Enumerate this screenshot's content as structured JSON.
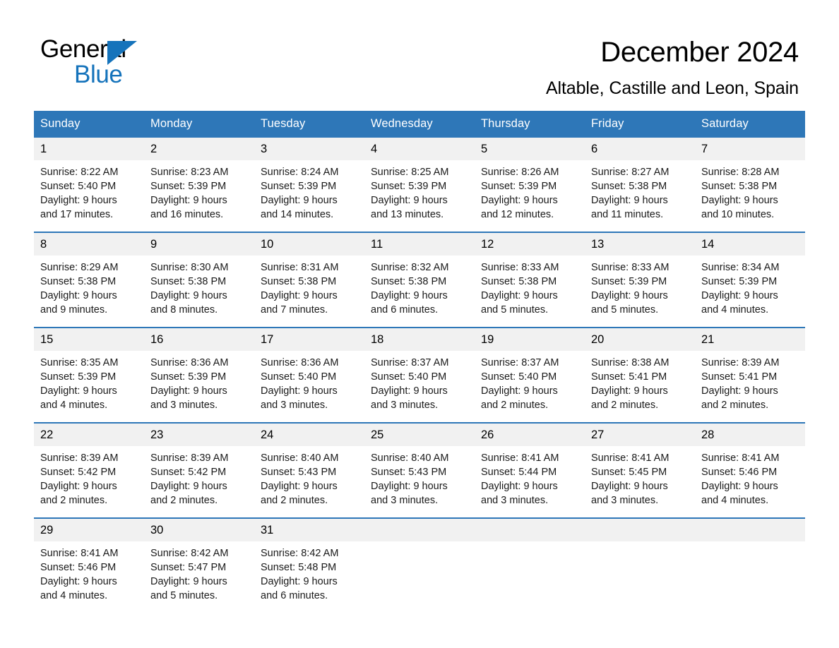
{
  "brand": {
    "word1": "General",
    "word2": "Blue",
    "triangle_color": "#1573bb"
  },
  "header": {
    "title": "December 2024",
    "subtitle": "Altable, Castille and Leon, Spain"
  },
  "theme": {
    "header_blue": "#2e77b8",
    "daynum_bg": "#f1f1f1",
    "page_bg": "#ffffff"
  },
  "weekday_headers": [
    "Sunday",
    "Monday",
    "Tuesday",
    "Wednesday",
    "Thursday",
    "Friday",
    "Saturday"
  ],
  "weeks": [
    [
      {
        "day": "1",
        "sunrise": "Sunrise: 8:22 AM",
        "sunset": "Sunset: 5:40 PM",
        "daylight1": "Daylight: 9 hours",
        "daylight2": "and 17 minutes."
      },
      {
        "day": "2",
        "sunrise": "Sunrise: 8:23 AM",
        "sunset": "Sunset: 5:39 PM",
        "daylight1": "Daylight: 9 hours",
        "daylight2": "and 16 minutes."
      },
      {
        "day": "3",
        "sunrise": "Sunrise: 8:24 AM",
        "sunset": "Sunset: 5:39 PM",
        "daylight1": "Daylight: 9 hours",
        "daylight2": "and 14 minutes."
      },
      {
        "day": "4",
        "sunrise": "Sunrise: 8:25 AM",
        "sunset": "Sunset: 5:39 PM",
        "daylight1": "Daylight: 9 hours",
        "daylight2": "and 13 minutes."
      },
      {
        "day": "5",
        "sunrise": "Sunrise: 8:26 AM",
        "sunset": "Sunset: 5:39 PM",
        "daylight1": "Daylight: 9 hours",
        "daylight2": "and 12 minutes."
      },
      {
        "day": "6",
        "sunrise": "Sunrise: 8:27 AM",
        "sunset": "Sunset: 5:38 PM",
        "daylight1": "Daylight: 9 hours",
        "daylight2": "and 11 minutes."
      },
      {
        "day": "7",
        "sunrise": "Sunrise: 8:28 AM",
        "sunset": "Sunset: 5:38 PM",
        "daylight1": "Daylight: 9 hours",
        "daylight2": "and 10 minutes."
      }
    ],
    [
      {
        "day": "8",
        "sunrise": "Sunrise: 8:29 AM",
        "sunset": "Sunset: 5:38 PM",
        "daylight1": "Daylight: 9 hours",
        "daylight2": "and 9 minutes."
      },
      {
        "day": "9",
        "sunrise": "Sunrise: 8:30 AM",
        "sunset": "Sunset: 5:38 PM",
        "daylight1": "Daylight: 9 hours",
        "daylight2": "and 8 minutes."
      },
      {
        "day": "10",
        "sunrise": "Sunrise: 8:31 AM",
        "sunset": "Sunset: 5:38 PM",
        "daylight1": "Daylight: 9 hours",
        "daylight2": "and 7 minutes."
      },
      {
        "day": "11",
        "sunrise": "Sunrise: 8:32 AM",
        "sunset": "Sunset: 5:38 PM",
        "daylight1": "Daylight: 9 hours",
        "daylight2": "and 6 minutes."
      },
      {
        "day": "12",
        "sunrise": "Sunrise: 8:33 AM",
        "sunset": "Sunset: 5:38 PM",
        "daylight1": "Daylight: 9 hours",
        "daylight2": "and 5 minutes."
      },
      {
        "day": "13",
        "sunrise": "Sunrise: 8:33 AM",
        "sunset": "Sunset: 5:39 PM",
        "daylight1": "Daylight: 9 hours",
        "daylight2": "and 5 minutes."
      },
      {
        "day": "14",
        "sunrise": "Sunrise: 8:34 AM",
        "sunset": "Sunset: 5:39 PM",
        "daylight1": "Daylight: 9 hours",
        "daylight2": "and 4 minutes."
      }
    ],
    [
      {
        "day": "15",
        "sunrise": "Sunrise: 8:35 AM",
        "sunset": "Sunset: 5:39 PM",
        "daylight1": "Daylight: 9 hours",
        "daylight2": "and 4 minutes."
      },
      {
        "day": "16",
        "sunrise": "Sunrise: 8:36 AM",
        "sunset": "Sunset: 5:39 PM",
        "daylight1": "Daylight: 9 hours",
        "daylight2": "and 3 minutes."
      },
      {
        "day": "17",
        "sunrise": "Sunrise: 8:36 AM",
        "sunset": "Sunset: 5:40 PM",
        "daylight1": "Daylight: 9 hours",
        "daylight2": "and 3 minutes."
      },
      {
        "day": "18",
        "sunrise": "Sunrise: 8:37 AM",
        "sunset": "Sunset: 5:40 PM",
        "daylight1": "Daylight: 9 hours",
        "daylight2": "and 3 minutes."
      },
      {
        "day": "19",
        "sunrise": "Sunrise: 8:37 AM",
        "sunset": "Sunset: 5:40 PM",
        "daylight1": "Daylight: 9 hours",
        "daylight2": "and 2 minutes."
      },
      {
        "day": "20",
        "sunrise": "Sunrise: 8:38 AM",
        "sunset": "Sunset: 5:41 PM",
        "daylight1": "Daylight: 9 hours",
        "daylight2": "and 2 minutes."
      },
      {
        "day": "21",
        "sunrise": "Sunrise: 8:39 AM",
        "sunset": "Sunset: 5:41 PM",
        "daylight1": "Daylight: 9 hours",
        "daylight2": "and 2 minutes."
      }
    ],
    [
      {
        "day": "22",
        "sunrise": "Sunrise: 8:39 AM",
        "sunset": "Sunset: 5:42 PM",
        "daylight1": "Daylight: 9 hours",
        "daylight2": "and 2 minutes."
      },
      {
        "day": "23",
        "sunrise": "Sunrise: 8:39 AM",
        "sunset": "Sunset: 5:42 PM",
        "daylight1": "Daylight: 9 hours",
        "daylight2": "and 2 minutes."
      },
      {
        "day": "24",
        "sunrise": "Sunrise: 8:40 AM",
        "sunset": "Sunset: 5:43 PM",
        "daylight1": "Daylight: 9 hours",
        "daylight2": "and 2 minutes."
      },
      {
        "day": "25",
        "sunrise": "Sunrise: 8:40 AM",
        "sunset": "Sunset: 5:43 PM",
        "daylight1": "Daylight: 9 hours",
        "daylight2": "and 3 minutes."
      },
      {
        "day": "26",
        "sunrise": "Sunrise: 8:41 AM",
        "sunset": "Sunset: 5:44 PM",
        "daylight1": "Daylight: 9 hours",
        "daylight2": "and 3 minutes."
      },
      {
        "day": "27",
        "sunrise": "Sunrise: 8:41 AM",
        "sunset": "Sunset: 5:45 PM",
        "daylight1": "Daylight: 9 hours",
        "daylight2": "and 3 minutes."
      },
      {
        "day": "28",
        "sunrise": "Sunrise: 8:41 AM",
        "sunset": "Sunset: 5:46 PM",
        "daylight1": "Daylight: 9 hours",
        "daylight2": "and 4 minutes."
      }
    ],
    [
      {
        "day": "29",
        "sunrise": "Sunrise: 8:41 AM",
        "sunset": "Sunset: 5:46 PM",
        "daylight1": "Daylight: 9 hours",
        "daylight2": "and 4 minutes."
      },
      {
        "day": "30",
        "sunrise": "Sunrise: 8:42 AM",
        "sunset": "Sunset: 5:47 PM",
        "daylight1": "Daylight: 9 hours",
        "daylight2": "and 5 minutes."
      },
      {
        "day": "31",
        "sunrise": "Sunrise: 8:42 AM",
        "sunset": "Sunset: 5:48 PM",
        "daylight1": "Daylight: 9 hours",
        "daylight2": "and 6 minutes."
      },
      {
        "day": "",
        "sunrise": "",
        "sunset": "",
        "daylight1": "",
        "daylight2": ""
      },
      {
        "day": "",
        "sunrise": "",
        "sunset": "",
        "daylight1": "",
        "daylight2": ""
      },
      {
        "day": "",
        "sunrise": "",
        "sunset": "",
        "daylight1": "",
        "daylight2": ""
      },
      {
        "day": "",
        "sunrise": "",
        "sunset": "",
        "daylight1": "",
        "daylight2": ""
      }
    ]
  ]
}
